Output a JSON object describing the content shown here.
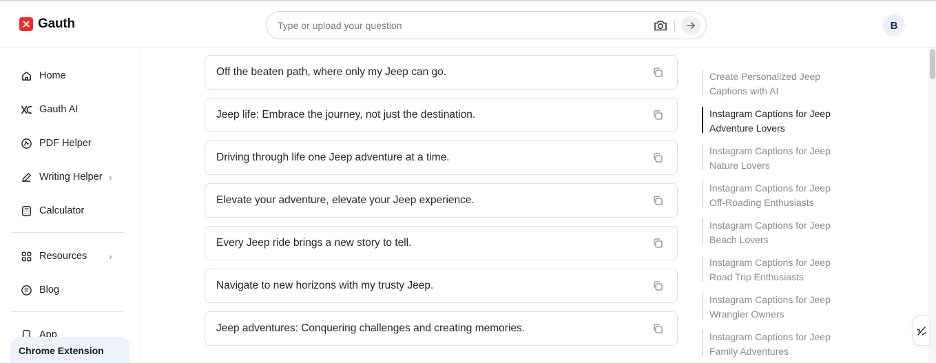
{
  "brand": {
    "name": "Gauth",
    "accent": "#ef2b2b"
  },
  "search": {
    "placeholder": "Type or upload your question"
  },
  "user": {
    "avatar_initial": "B"
  },
  "sidebar": {
    "items": [
      {
        "label": "Home",
        "icon": "home-icon"
      },
      {
        "label": "Gauth AI",
        "icon": "gauth-ai-icon"
      },
      {
        "label": "PDF Helper",
        "icon": "pdf-icon"
      },
      {
        "label": "Writing Helper",
        "icon": "pen-icon",
        "has_submenu": true
      },
      {
        "label": "Calculator",
        "icon": "calculator-icon"
      },
      {
        "label": "Resources",
        "icon": "grid-icon",
        "has_submenu": true
      },
      {
        "label": "Blog",
        "icon": "blog-icon"
      },
      {
        "label": "App",
        "icon": "phone-icon"
      }
    ],
    "chrome_extension": "Chrome Extension"
  },
  "captions": [
    "Off the beaten path, where only my Jeep can go.",
    "Jeep life: Embrace the journey, not just the destination.",
    "Driving through life one Jeep adventure at a time.",
    "Elevate your adventure, elevate your Jeep experience.",
    "Every Jeep ride brings a new story to tell.",
    "Navigate to new horizons with my trusty Jeep.",
    "Jeep adventures: Conquering challenges and creating memories."
  ],
  "toc": {
    "items": [
      {
        "line1": "Create Personalized Jeep",
        "line2": "Captions with AI",
        "active": false
      },
      {
        "line1": "Instagram Captions for Jeep",
        "line2": "Adventure Lovers",
        "active": true
      },
      {
        "line1": "Instagram Captions for Jeep",
        "line2": "Nature Lovers",
        "active": false
      },
      {
        "line1": "Instagram Captions for Jeep",
        "line2": "Off-Roading Enthusiasts",
        "active": false
      },
      {
        "line1": "Instagram Captions for Jeep",
        "line2": "Beach Lovers",
        "active": false
      },
      {
        "line1": "Instagram Captions for Jeep",
        "line2": "Road Trip Enthusiasts",
        "active": false
      },
      {
        "line1": "Instagram Captions for Jeep",
        "line2": "Wrangler Owners",
        "active": false
      },
      {
        "line1": "Instagram Captions for Jeep",
        "line2": "Family Adventures",
        "active": false
      }
    ]
  }
}
